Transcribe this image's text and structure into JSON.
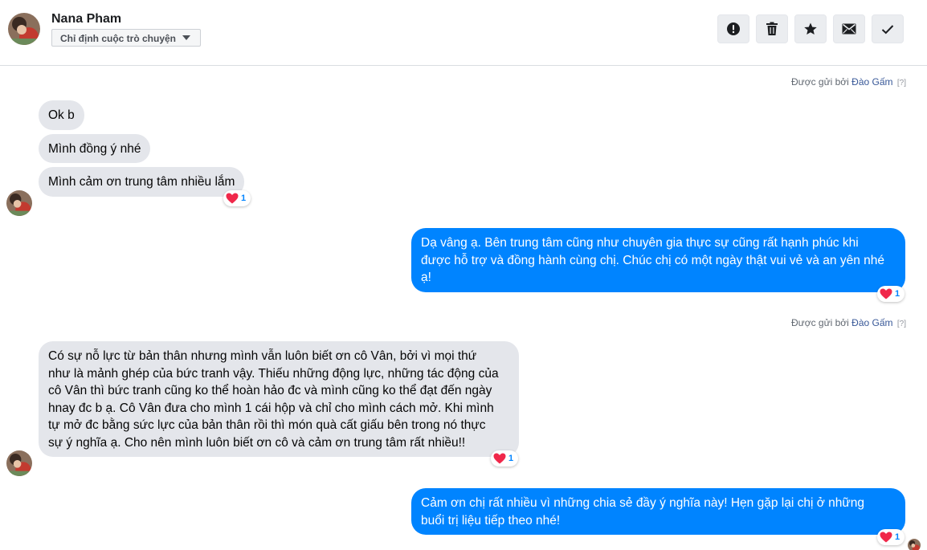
{
  "header": {
    "contact_name": "Nana Pham",
    "assign_label": "Chỉ định cuộc trò chuyện",
    "actions": [
      {
        "name": "mark-spam",
        "icon": "exclamation-circle-icon"
      },
      {
        "name": "delete",
        "icon": "trash-icon"
      },
      {
        "name": "star",
        "icon": "star-icon"
      },
      {
        "name": "mark-unread",
        "icon": "envelope-icon"
      },
      {
        "name": "mark-done",
        "icon": "check-icon"
      }
    ]
  },
  "sent_by": {
    "prefix": "Được gửi bởi",
    "agent": "Đào Gấm",
    "help": "[?]"
  },
  "messages": [
    {
      "direction": "incoming",
      "text": "Ok b"
    },
    {
      "direction": "incoming",
      "text": "Mình đồng ý nhé"
    },
    {
      "direction": "incoming",
      "text": "Mình cảm ơn trung tâm nhiều lắm",
      "reaction": {
        "icon": "heart-icon",
        "count": "1"
      }
    },
    {
      "direction": "outgoing",
      "lines": [
        "Dạ vâng ạ. Bên trung tâm cũng như chuyên gia thực sự cũng rất hạnh phúc khi",
        "được hỗ trợ và đồng hành cùng chị. Chúc chị có một ngày thật vui vẻ và an yên nhé",
        "ạ!"
      ],
      "reaction": {
        "icon": "heart-icon",
        "count": "1"
      }
    },
    {
      "direction": "incoming",
      "lines": [
        "Có sự nỗ lực từ bản thân nhưng mình vẫn luôn biết ơn cô Vân, bởi vì mọi thứ",
        "như là mảnh ghép của bức tranh vậy. Thiếu những động lực, những tác động của",
        "cô Vân thì bức tranh cũng ko thể hoàn hảo đc và mình cũng ko thể đạt đến ngày",
        "hnay đc b ạ. Cô Vân đưa cho mình 1 cái hộp và chỉ cho mình cách mở. Khi mình",
        "tự mở đc bằng sức lực của bản thân rồi thì món quà cất giấu bên trong nó thực",
        "sự ý nghĩa ạ. Cho nên mình luôn biết ơn cô và cảm ơn trung tâm rất nhiều!!"
      ],
      "reaction": {
        "icon": "heart-icon",
        "count": "1"
      }
    },
    {
      "direction": "outgoing",
      "lines": [
        "Cảm ơn chị rất nhiều vì những chia sẻ đầy ý nghĩa này! Hẹn gặp lại chị ở những",
        "buổi trị liệu tiếp theo nhé!"
      ],
      "reaction": {
        "icon": "heart-icon",
        "count": "1"
      }
    }
  ],
  "colors": {
    "outgoing_bubble": "#0084ff",
    "incoming_bubble": "#e4e6eb",
    "agent_link": "#385898",
    "heart": "#f0284a"
  }
}
